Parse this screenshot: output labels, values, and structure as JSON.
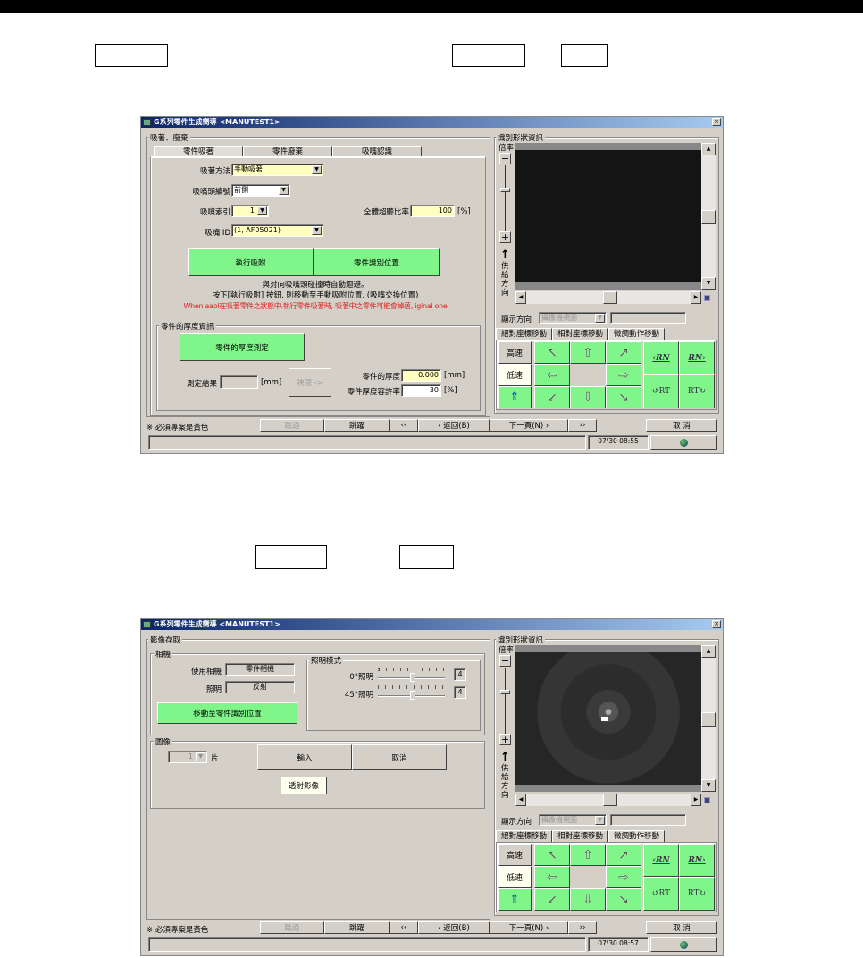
{
  "shared": {
    "close": "×",
    "shape_info": "識別形狀資訊",
    "zoom_label": "倍率",
    "feed_dir": "供給方向",
    "display_dir_label": "顯示方向",
    "display_dir_value": "攝像機視圖",
    "move_tabs": [
      "絕對座標移動",
      "相對座標移動",
      "微調動作移動"
    ],
    "high_speed": "高速",
    "low_speed": "低速",
    "rn_left": "‹RN",
    "rn_right": "RN›",
    "rt_left": "↺RT",
    "rt_right": "RT↻",
    "required_note": "※ 必須專案是黃色",
    "btn_skip": "跳過",
    "btn_jump": "跳躍",
    "btn_first": "‹‹",
    "btn_back": "‹ 返回(B)",
    "btn_next": "下一頁(N) ›",
    "btn_last": "››",
    "btn_cancel": "取 消"
  },
  "dialog1": {
    "title": "G系列零件生成嚮導 <MANUTEST1>",
    "group": "吸著、廢棄",
    "tabs": [
      "零件吸著",
      "零件廢棄",
      "吸嘴認識"
    ],
    "pick_method_label": "吸著方法",
    "pick_method": "手動吸著",
    "head_no_label": "吸嘴頭編號",
    "head_no": "前側",
    "nozzle_index_label": "吸嘴索引",
    "nozzle_index": "1",
    "overall_rate_label": "全體超聽比率",
    "overall_rate": "100",
    "pct": "[%]",
    "nozzle_id_label": "吸嘴 ID",
    "nozzle_id": "(1, AF05021)",
    "btn_execute_pick": "執行吸附",
    "btn_part_recog_pos": "零件識別位置",
    "msg1": "與对向吸嘴頭碰撞時自動迴避。",
    "msg2": "按下[執行吸附] 按鈕, 則移動至手動吸附位置. (吸嘴交換位置)",
    "msg_warn": "When aaol在吸著零件之狀態中.執行零件吸著時, 吸著中之零件可能會掉落, iginal one",
    "thickness_group": "零件的厚度資訊",
    "btn_measure": "零件的厚度測定",
    "result_label": "測定結果",
    "mm": "[mm]",
    "btn_apply": "映現 ->",
    "thickness_label": "零件的厚度",
    "thickness": "0.000",
    "tolerance_label": "零件厚度容許率",
    "tolerance": "30",
    "timestamp": "07/30 08:55",
    "accent": "#7ff58a",
    "warn_color": "#e02020"
  },
  "dialog2": {
    "title": "G系列零件生成嚮導 <MANUTEST1>",
    "group": "影像存取",
    "camera_group": "相機",
    "camera_label": "使用相機",
    "camera": "零件相機",
    "light_label": "照明",
    "light": "反射",
    "light_mode_group": "照明模式",
    "light0_label": "0°照明",
    "light0": "4",
    "light45_label": "45°照明",
    "light45": "4",
    "btn_move_recog": "移動至零件識別位置",
    "image_group": "圖像",
    "pieces": "1",
    "pieces_unit": "片",
    "btn_input": "輸入",
    "btn_cancel": "取消",
    "btn_transmit": "透射影像",
    "timestamp": "07/30 08:57"
  }
}
